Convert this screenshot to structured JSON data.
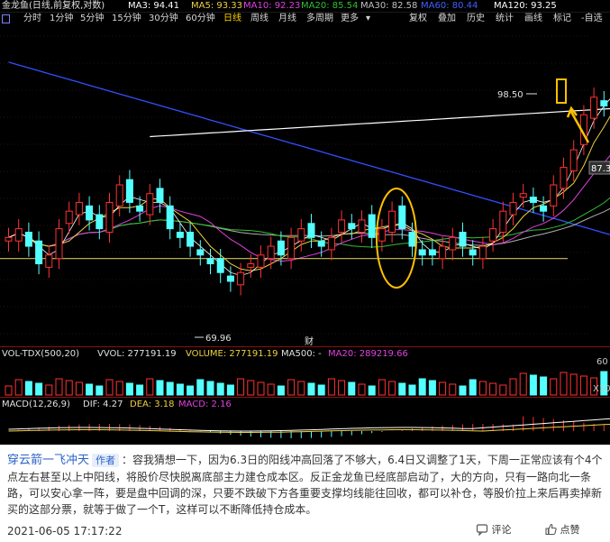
{
  "chart_title": "金龙鱼(日线,前复权,对数)",
  "ma_labels": [
    {
      "text": "MA3: 94.41",
      "color": "#ffffff"
    },
    {
      "text": "MA5: 93.33",
      "color": "#f0d040"
    },
    {
      "text": "MA10: 92.23",
      "color": "#e040e0"
    },
    {
      "text": "MA20: 85.54",
      "color": "#30c030"
    },
    {
      "text": "MA30: 82.58",
      "color": "#c0c0c0"
    },
    {
      "text": "MA60: 80.44",
      "color": "#4060ff"
    },
    {
      "text": "MA120: 93.25",
      "color": "#ffffff"
    }
  ],
  "toolbar": {
    "periods": [
      "分时",
      "1分钟",
      "5分钟",
      "15分钟",
      "30分钟",
      "60分钟",
      "日线",
      "周线",
      "月线",
      "多周期",
      "更多"
    ],
    "active_period": "日线",
    "right": [
      "复权",
      "叠加",
      "历史",
      "统计",
      "画线",
      "标记",
      "-自选"
    ]
  },
  "price_labels": {
    "high": "98.50",
    "low": "69.96",
    "last": "87.3"
  },
  "finance_marker": "财",
  "volume": {
    "title": "VOL-TDX(500,20)",
    "vvol": "VVOL: 277191.19",
    "volume": "VOLUME: 277191.19",
    "ma500": "MA500: -",
    "ma20": "MA20: 289219.66",
    "axis": [
      "60",
      "X10"
    ]
  },
  "macd": {
    "title": "MACD(12,26,9)",
    "dif": "DIF: 4.27",
    "dea": "DEA: 3.18",
    "macd": "MACD: 2.16"
  },
  "comment": {
    "author": "穿云箭一飞冲天",
    "badge": "作者",
    "text": "：容我猜想一下，因为6.3日的阳线冲高回落了不够大，6.4日又调整了1天，下周一正常应该有个4个点左右甚至以上中阳线，将股价尽快脱离底部主力建仓成本区。反正金龙鱼已经底部启动了，大的方向，只有一路向北一条路，可以安心拿一阵，要是盘中回调的深，只要不跌破下方各重要支撑均线能往回收，都可以补仓，等股价拉上来后再卖掉新买的这部分票，就等于做了一个T，这样可以不断降低持仓成本。",
    "time": "2021-06-05 17:17:22",
    "reply_label": "评论",
    "like_label": "点赞"
  },
  "colors": {
    "up": "#ff3232",
    "down": "#54ffff",
    "accent_annotation": "#ffc000"
  }
}
